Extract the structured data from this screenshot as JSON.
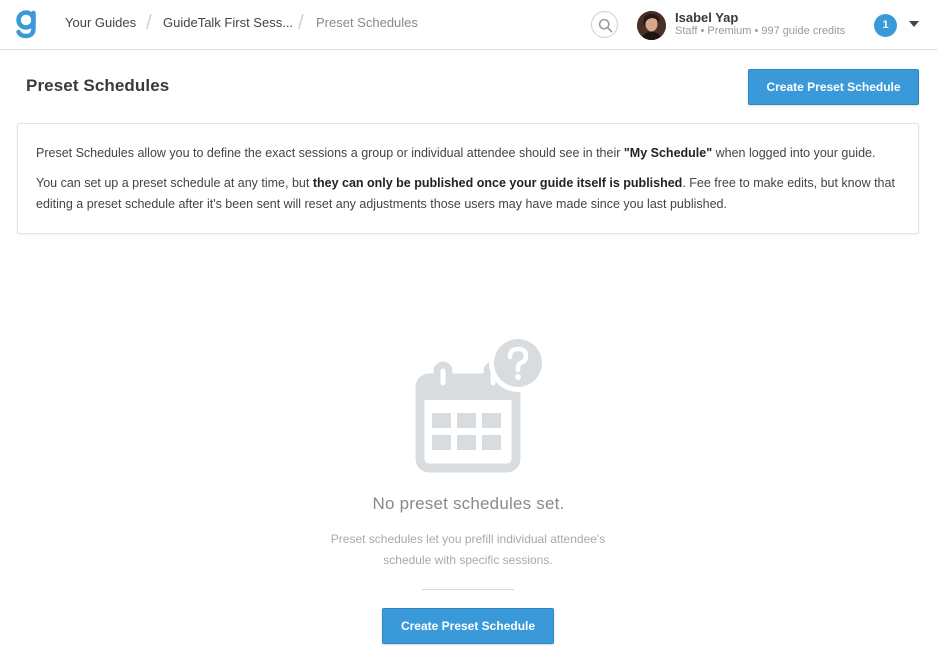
{
  "app": {
    "logo_icon": "guidebook-logo-icon",
    "brand_color": "#3a9ad9"
  },
  "breadcrumb": {
    "items": [
      "Your Guides",
      "GuideTalk First Sess...",
      "Preset Schedules"
    ]
  },
  "user": {
    "name": "Isabel Yap",
    "meta": "Staff • Premium • 997 guide credits",
    "notifications": "1"
  },
  "page": {
    "title": "Preset Schedules",
    "create_label": "Create Preset Schedule"
  },
  "info": {
    "p1_before": "Preset Schedules allow you to define the exact sessions a group or individual attendee should see in their ",
    "p1_bold": "\"My Schedule\"",
    "p1_after": " when logged into your guide.",
    "p2_before": "You can set up a preset schedule at any time, but ",
    "p2_bold": "they can only be published once your guide itself is published",
    "p2_after": ". Fee free to make edits, but know that editing a preset schedule after it's been sent will reset any adjustments those users may have made since you last published."
  },
  "empty_state": {
    "icon": "calendar-question-icon",
    "title": "No preset schedules set.",
    "description": "Preset schedules let you prefill individual attendee's schedule with specific sessions.",
    "button_label": "Create Preset Schedule"
  }
}
